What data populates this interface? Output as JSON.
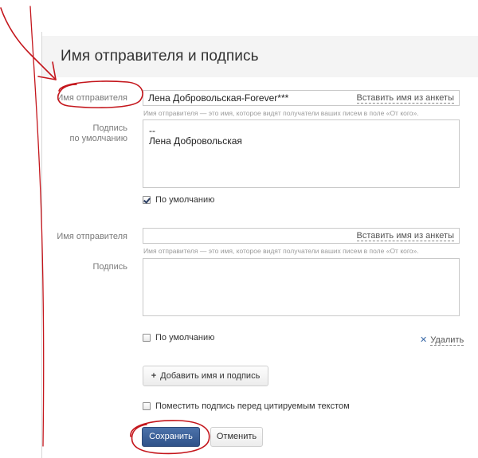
{
  "header": {
    "title": "Имя отправителя и подпись"
  },
  "sender1": {
    "name_label": "Имя отправителя",
    "name_value": "Лена Добровольская-Forever***",
    "insert_link": "Вставить имя из анкеты",
    "hint": "Имя отправителя — это имя, которое видят получатели ваших писем в поле «От кого».",
    "signature_label_line1": "Подпись",
    "signature_label_line2": "по умолчанию",
    "signature_line1": "--",
    "signature_line2": "Лена Добровольская",
    "default_checkbox_label": "По умолчанию",
    "default_checked": true
  },
  "sender2": {
    "name_label": "Имя отправителя",
    "name_value": "",
    "insert_link": "Вставить имя из анкеты",
    "hint": "Имя отправителя — это имя, которое видят получатели ваших писем в поле «От кого».",
    "signature_label": "Подпись",
    "signature_value": "",
    "default_checkbox_label": "По умолчанию",
    "default_checked": false,
    "delete_label": "Удалить"
  },
  "actions": {
    "add_label": "Добавить имя и подпись",
    "place_signature_label": "Поместить подпись перед цитируемым текстом",
    "place_signature_checked": false,
    "save_label": "Сохранить",
    "cancel_label": "Отменить"
  },
  "icons": {
    "checkbox_check": "check-icon",
    "add": "plus-icon",
    "delete": "close-icon"
  },
  "colors": {
    "primary_button": "#3a5f97",
    "annotation_red": "#c4161c",
    "label_gray": "#7a7a7a"
  }
}
